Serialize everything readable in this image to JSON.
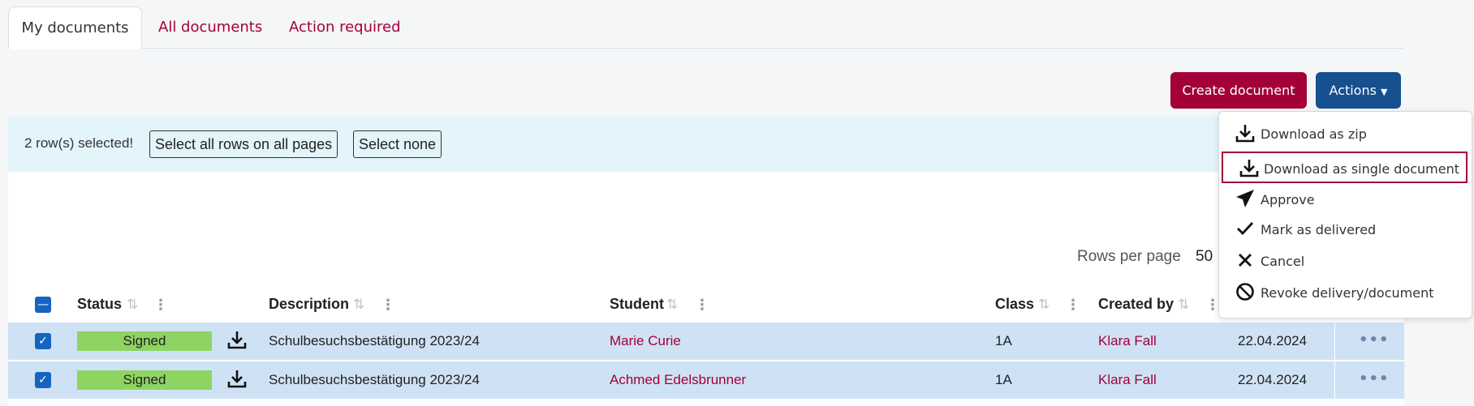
{
  "tabs": [
    {
      "label": "My documents"
    },
    {
      "label": "All documents"
    },
    {
      "label": "Action required"
    }
  ],
  "toolbar": {
    "create_label": "Create document",
    "actions_label": "Actions"
  },
  "selection": {
    "message": "2 row(s) selected!",
    "select_all_label": "Select all rows on all pages",
    "select_none_label": "Select none"
  },
  "pagination": {
    "rows_per_page_label": "Rows per page",
    "rows_per_page_value": "50"
  },
  "table": {
    "columns": {
      "status": "Status",
      "description": "Description",
      "student": "Student",
      "class": "Class",
      "created_by": "Created by"
    },
    "rows": [
      {
        "status": "Signed",
        "description": "Schulbesuchsbestätigung 2023/24",
        "student": "Marie Curie",
        "class": "1A",
        "created_by": "Klara Fall",
        "date": "22.04.2024"
      },
      {
        "status": "Signed",
        "description": "Schulbesuchsbestätigung 2023/24",
        "student": "Achmed Edelsbrunner",
        "class": "1A",
        "created_by": "Klara Fall",
        "date": "22.04.2024"
      }
    ]
  },
  "actions_menu": {
    "items": [
      {
        "label": "Download as zip",
        "icon": "download-icon"
      },
      {
        "label": "Download as single document",
        "icon": "download-icon"
      },
      {
        "label": "Approve",
        "icon": "paper-plane-icon"
      },
      {
        "label": "Mark as delivered",
        "icon": "check-icon"
      },
      {
        "label": "Cancel",
        "icon": "close-icon"
      },
      {
        "label": "Revoke delivery/document",
        "icon": "ban-icon"
      }
    ]
  },
  "colors": {
    "brand": "#a3003a",
    "primary": "#16508f",
    "selection_bar": "#e3f4fb",
    "selected_row": "#cfe2f5",
    "signed_badge": "#8ed462"
  }
}
